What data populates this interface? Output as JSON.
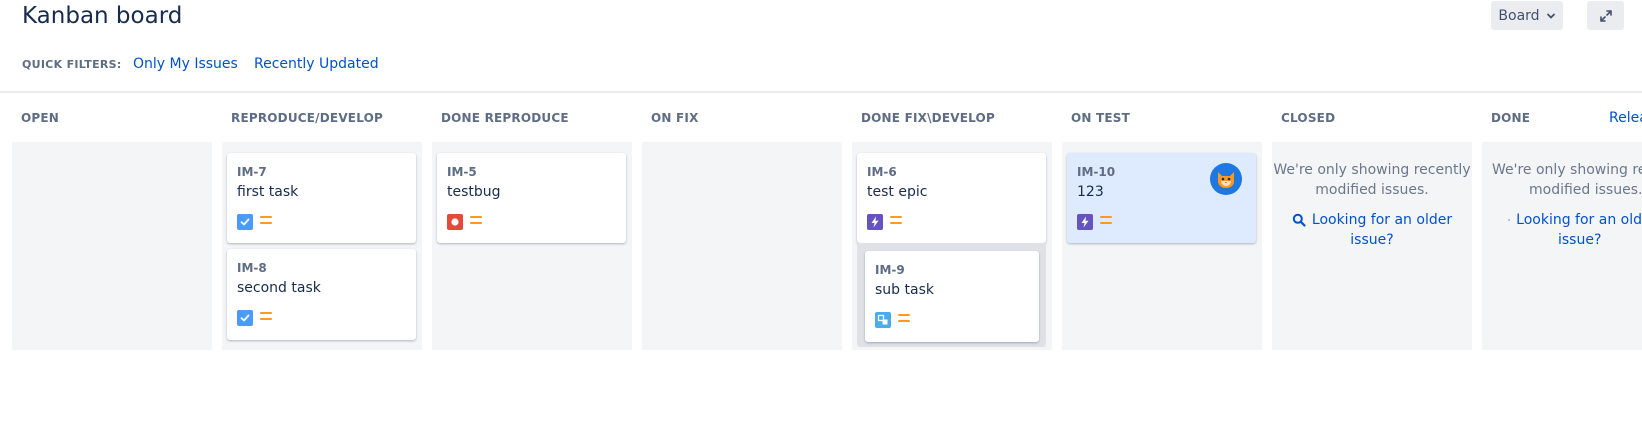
{
  "header": {
    "title": "Kanban board",
    "board_button_label": "Board",
    "expand_icon": "expand-icon"
  },
  "quick_filters": {
    "label": "QUICK FILTERS:",
    "items": [
      "Only My Issues",
      "Recently Updated"
    ]
  },
  "release_link": "Relea",
  "columns": [
    {
      "name": "OPEN"
    },
    {
      "name": "REPRODUCE/DEVELOP"
    },
    {
      "name": "DONE REPRODUCE"
    },
    {
      "name": "ON FIX"
    },
    {
      "name": "DONE FIX\\DEVELOP"
    },
    {
      "name": "ON TEST"
    },
    {
      "name": "CLOSED"
    },
    {
      "name": "DONE"
    }
  ],
  "cards": [
    {
      "key": "IM-7",
      "summary": "first task",
      "type": "task",
      "type_icon": "task-checkbox-icon",
      "priority": "medium",
      "column": "REPRODUCE/DEVELOP"
    },
    {
      "key": "IM-8",
      "summary": "second task",
      "type": "task",
      "type_icon": "task-checkbox-icon",
      "priority": "medium",
      "column": "REPRODUCE/DEVELOP"
    },
    {
      "key": "IM-5",
      "summary": "testbug",
      "type": "bug",
      "type_icon": "bug-icon",
      "priority": "medium",
      "column": "DONE REPRODUCE"
    },
    {
      "key": "IM-6",
      "summary": "test epic",
      "type": "epic",
      "type_icon": "epic-lightning-icon",
      "priority": "medium",
      "column": "DONE FIX\\DEVELOP"
    },
    {
      "key": "IM-9",
      "summary": "sub task",
      "type": "subtask",
      "type_icon": "subtask-icon",
      "priority": "medium",
      "column": "DONE FIX\\DEVELOP"
    },
    {
      "key": "IM-10",
      "summary": "123",
      "type": "epic",
      "type_icon": "epic-lightning-icon",
      "priority": "medium",
      "column": "ON TEST",
      "selected": true,
      "assignee_avatar": "cat-avatar"
    }
  ],
  "empty_column": {
    "message_line1": "We're only showing recently",
    "message_line2": "modified issues.",
    "link_line1": "Looking for an older",
    "link_line2": "issue?"
  },
  "empty_column_clipped": {
    "message_line1": "We're only showing rece",
    "message_line2": "modified issues.",
    "link_line1": "Looking for an old",
    "link_line2": "issue?"
  },
  "colors": {
    "link": "#0052cc",
    "column_bg": "#f4f5f7",
    "selected_card_bg": "#deebff",
    "task_icon": "#4c9aff",
    "bug_icon": "#e5493a",
    "epic_icon": "#6554c0",
    "subtask_icon": "#4bade8",
    "priority_medium": "#ff991f"
  }
}
